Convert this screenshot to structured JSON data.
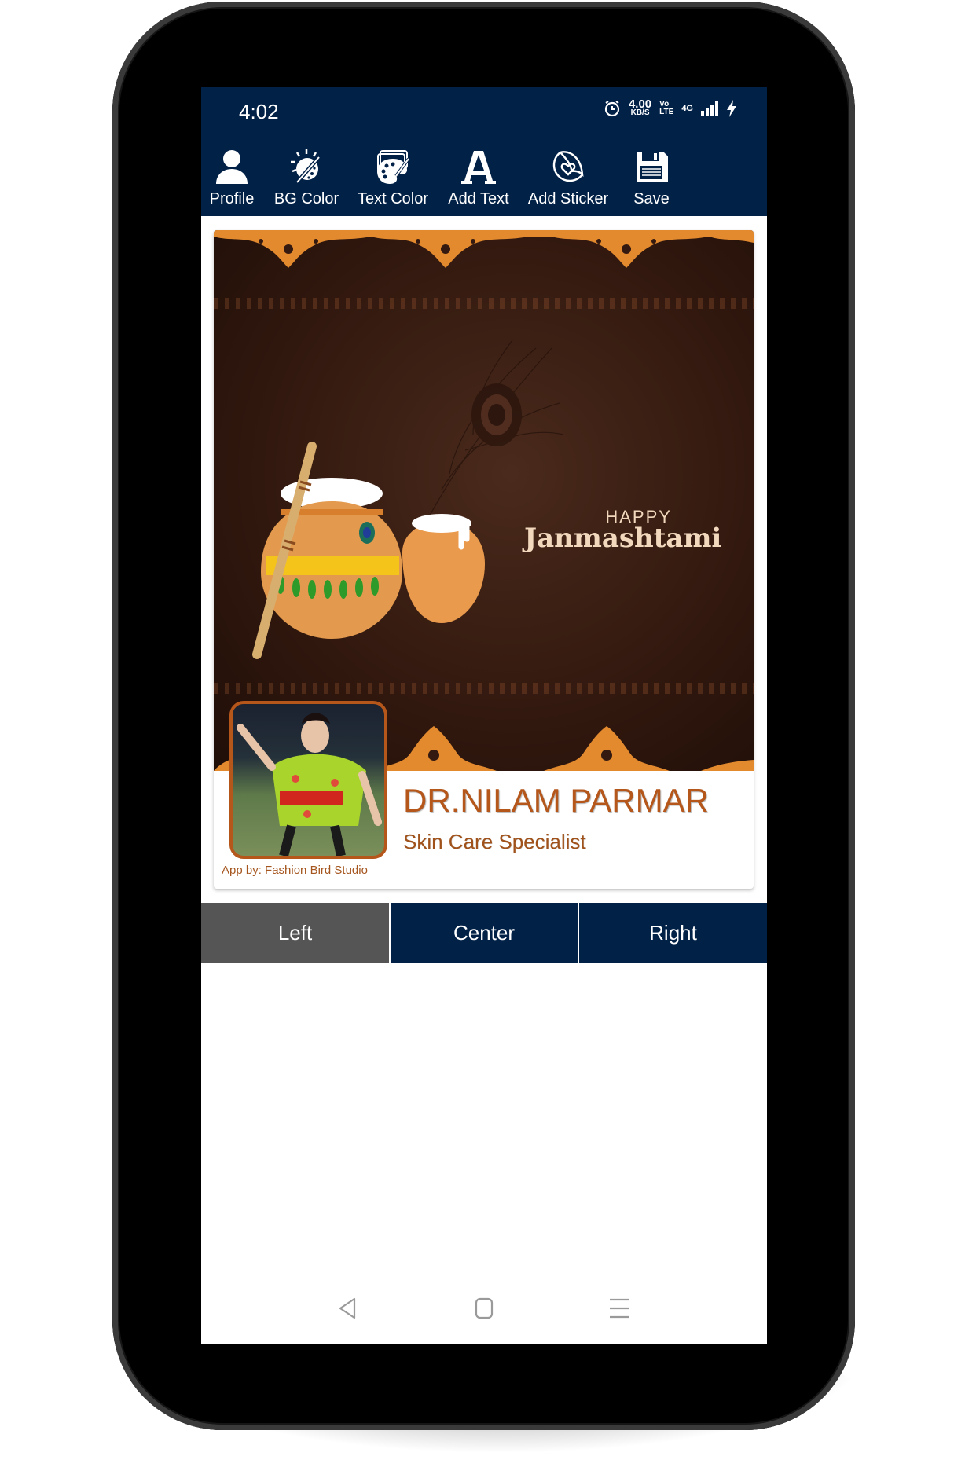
{
  "status_bar": {
    "time": "4:02",
    "net_speed_value": "4.00",
    "net_speed_unit": "KB/S",
    "volte_top": "Vo",
    "volte_bottom": "LTE",
    "network_type": "4G",
    "icons": [
      "alarm-icon",
      "signal-icon",
      "charging-icon"
    ]
  },
  "toolbar": {
    "items": [
      {
        "label": "Profile",
        "icon": "profile-icon"
      },
      {
        "label": "BG Color",
        "icon": "bg-color-icon"
      },
      {
        "label": "Text Color",
        "icon": "palette-icon"
      },
      {
        "label": "Add Text",
        "icon": "text-a-icon"
      },
      {
        "label": "Add Sticker",
        "icon": "sticker-heart-icon"
      },
      {
        "label": "Save",
        "icon": "floppy-save-icon"
      }
    ]
  },
  "card": {
    "greeting_small": "HAPPY",
    "greeting_main": "Janmashtami",
    "name": "DR.NILAM PARMAR",
    "designation": "Skin Care Specialist",
    "credit": "App by: Fashion Bird Studio"
  },
  "alignment": {
    "options": [
      "Left",
      "Center",
      "Right"
    ],
    "selected": "Left"
  },
  "colors": {
    "primary_navy": "#022147",
    "selected_gray": "#555555",
    "name_text": "#b5561a",
    "ornament_orange": "#e38a2f"
  },
  "nav_bar": {
    "buttons": [
      "back-icon",
      "home-icon",
      "menu-icon"
    ]
  }
}
